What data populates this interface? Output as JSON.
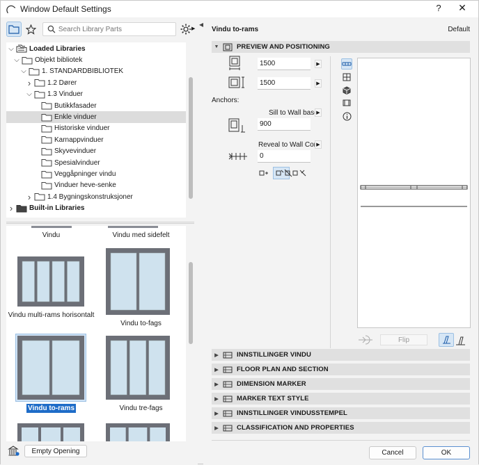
{
  "window": {
    "title": "Window Default Settings",
    "help_label": "?",
    "close_label": "✕"
  },
  "library": {
    "search_placeholder": "Search Library Parts",
    "tree": [
      {
        "label": "Loaded Libraries",
        "level": 0,
        "expanded": true,
        "bold": true,
        "kind": "stack"
      },
      {
        "label": "Objekt bibliotek",
        "level": 1,
        "expanded": true,
        "bold": false,
        "kind": "folder"
      },
      {
        "label": "1. STANDARDBIBLIOTEK",
        "level": 2,
        "expanded": true,
        "bold": false,
        "kind": "folder"
      },
      {
        "label": "1.2 Dører",
        "level": 3,
        "expanded": false,
        "bold": false,
        "kind": "folder"
      },
      {
        "label": "1.3 Vinduer",
        "level": 3,
        "expanded": true,
        "bold": false,
        "kind": "folder"
      },
      {
        "label": "Butikkfasader",
        "level": 4,
        "leaf": true,
        "bold": false,
        "kind": "folder"
      },
      {
        "label": "Enkle vinduer",
        "level": 4,
        "leaf": true,
        "bold": false,
        "kind": "folder",
        "selected": true
      },
      {
        "label": "Historiske vinduer",
        "level": 4,
        "leaf": true,
        "bold": false,
        "kind": "folder"
      },
      {
        "label": "Karnappvinduer",
        "level": 4,
        "leaf": true,
        "bold": false,
        "kind": "folder"
      },
      {
        "label": "Skyvevinduer",
        "level": 4,
        "leaf": true,
        "bold": false,
        "kind": "folder"
      },
      {
        "label": "Spesialvinduer",
        "level": 4,
        "leaf": true,
        "bold": false,
        "kind": "folder"
      },
      {
        "label": "Veggåpninger vindu",
        "level": 4,
        "leaf": true,
        "bold": false,
        "kind": "folder"
      },
      {
        "label": "Vinduer heve-senke",
        "level": 4,
        "leaf": true,
        "bold": false,
        "kind": "folder"
      },
      {
        "label": "1.4 Bygningskonstruksjoner",
        "level": 3,
        "expanded": false,
        "bold": false,
        "kind": "folder"
      },
      {
        "label": "Built-in Libraries",
        "level": 0,
        "expanded": false,
        "bold": true,
        "kind": "darkfolder"
      }
    ],
    "gallery": [
      {
        "label": "Vindu",
        "type": "partial"
      },
      {
        "label": "Vindu med sidefelt",
        "type": "partial"
      },
      {
        "label": "Vindu multi-rams horisontalt",
        "type": "multi"
      },
      {
        "label": "Vindu to-fags",
        "type": "twofags"
      },
      {
        "label": "Vindu to-rams",
        "type": "torams",
        "selected": true
      },
      {
        "label": "Vindu tre-fags",
        "type": "trefags"
      }
    ],
    "empty_opening_label": "Empty Opening"
  },
  "settings": {
    "part_name": "Vindu to-rams",
    "default_label": "Default",
    "sections": {
      "preview": "PREVIEW AND POSITIONING",
      "collapsed": [
        "INNSTILLINGER VINDU",
        "FLOOR PLAN AND SECTION",
        "DIMENSION MARKER",
        "MARKER TEXT STYLE",
        "INNSTILLINGER VINDUSSTEMPEL",
        "CLASSIFICATION AND PROPERTIES"
      ]
    },
    "width_value": "1500",
    "height_value": "1500",
    "anchors_label": "Anchors:",
    "sill_label": "Sill to Wall base",
    "sill_value": "900",
    "reveal_label": "Reveal to Wall Core",
    "reveal_value": "0",
    "flip_label": "Flip"
  },
  "footer": {
    "cancel_label": "Cancel",
    "ok_label": "OK"
  },
  "colors": {
    "accent": "#1e6cc8",
    "frame": "#6c6f77",
    "glass": "#cfe2ee"
  }
}
